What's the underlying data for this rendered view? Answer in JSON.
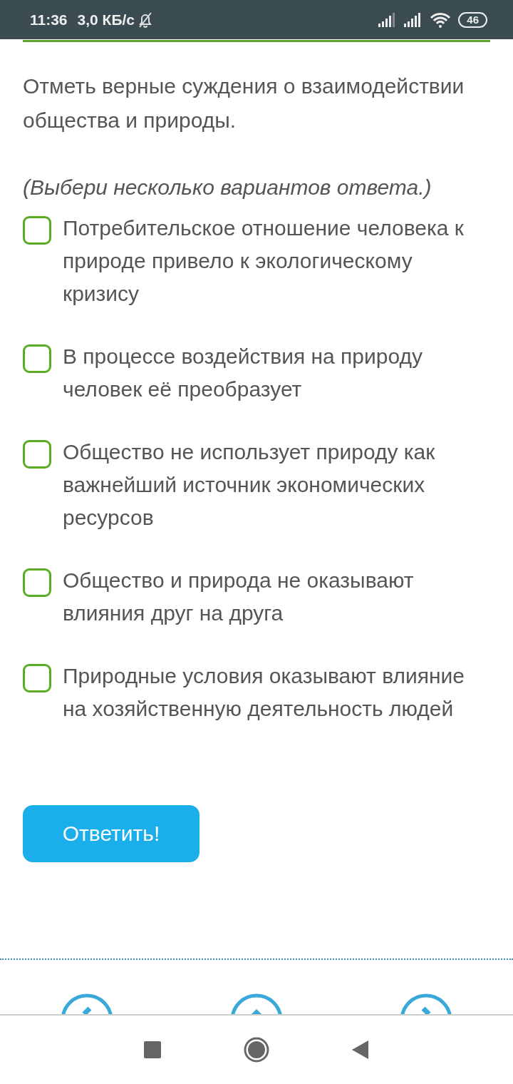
{
  "status_bar": {
    "time": "11:36",
    "speed": "3,0 КБ/с",
    "battery": "46"
  },
  "question": "Отметь верные суждения о взаимодействии общества и природы.",
  "hint": "(Выбери несколько вариантов ответа.)",
  "options": [
    {
      "text": "Потребительское отношение человека к природе привело к экологическому кризису",
      "checked": false
    },
    {
      "text": "В процессе воздействия на природу человек её преобразует",
      "checked": false
    },
    {
      "text": "Общество не использует природу как важнейший источник экономических ресурсов",
      "checked": false
    },
    {
      "text": "Общество и природа не оказывают влияния друг на друга",
      "checked": false
    },
    {
      "text": "Природные условия оказывают влияние на хозяйственную деятельность людей",
      "checked": false
    }
  ],
  "submit_button": "Ответить!"
}
